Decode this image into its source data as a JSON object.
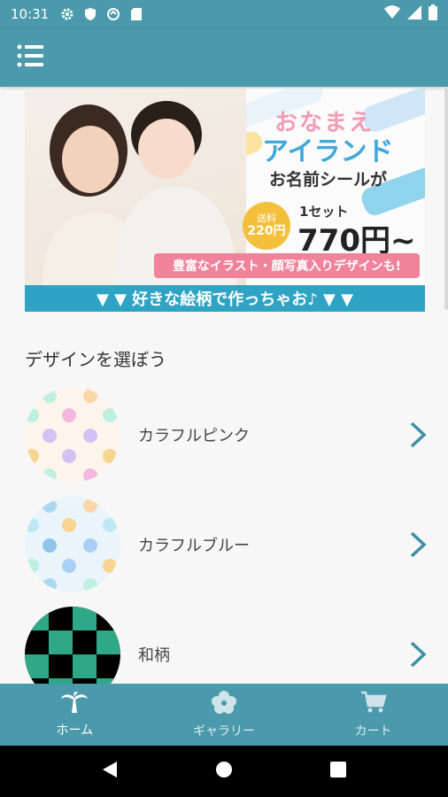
{
  "status_bar": {
    "time": "10:31",
    "icons": [
      "gear-icon",
      "shield-icon",
      "sync-icon",
      "sd-card-icon",
      "wifi-icon",
      "signal-icon",
      "battery-icon"
    ]
  },
  "app_bar": {
    "menu_icon": "list-menu-icon"
  },
  "banner": {
    "logo_line1": "おなまえ",
    "logo_line2": "アイランド",
    "tagline": "お名前シールが",
    "shipping_label": "送料",
    "shipping_value": "220円",
    "set_label": "1セット",
    "price": "770円~",
    "note": "豊富なイラスト・顔写真入りデザインも!",
    "cta": "▼ ▼ 好きな絵柄で作っちゃお♪ ▼ ▼"
  },
  "section_title": "デザインを選ぼう",
  "designs": [
    {
      "label": "カラフルピンク"
    },
    {
      "label": "カラフルブルー"
    },
    {
      "label": "和柄"
    }
  ],
  "bottom_nav": [
    {
      "label": "ホーム",
      "icon": "palm-tree-icon"
    },
    {
      "label": "ギャラリー",
      "icon": "hibiscus-icon"
    },
    {
      "label": "カート",
      "icon": "cart-icon"
    }
  ],
  "system_nav": {
    "back": "back-icon",
    "home": "home-icon",
    "recents": "recents-icon"
  },
  "colors": {
    "primary": "#4a9aab",
    "accent_blue": "#2fa3c4",
    "pink": "#f0839a",
    "yellow": "#f3c03b"
  }
}
